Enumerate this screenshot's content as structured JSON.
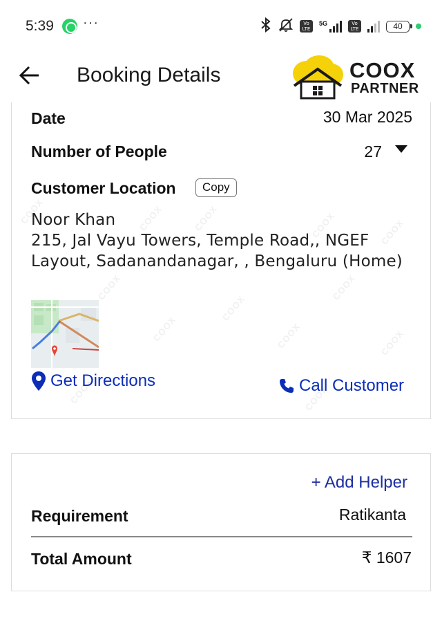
{
  "status_bar": {
    "time": "5:39",
    "overflow_dots": "···",
    "network_label": "5G",
    "volte_label": "Vo\nLTE",
    "battery_level": "40"
  },
  "app_bar": {
    "title": "Booking Details",
    "logo_primary": "COOX",
    "logo_secondary": "PARTNER"
  },
  "booking": {
    "date_label": "Date",
    "date_value": "30 Mar 2025",
    "people_label": "Number of People",
    "people_value": "27",
    "location_label": "Customer Location",
    "copy_label": "Copy",
    "customer_name": "Noor Khan",
    "address_line_1": "215, Jal Vayu Towers, Temple Road,, NGEF",
    "address_line_2": "Layout, Sadanandanagar, , Bengaluru (Home)",
    "directions_label": "Get Directions",
    "call_label": "Call Customer"
  },
  "summary": {
    "add_helper_label": "+ Add Helper",
    "requirement_label": "Requirement",
    "requirement_value": "Ratikanta",
    "total_label": "Total Amount",
    "total_value": "₹ 1607"
  },
  "colors": {
    "accent_blue": "#0b2db8",
    "logo_yellow": "#f5d10a",
    "status_green": "#2ecc71"
  },
  "watermark_text": "COOX"
}
